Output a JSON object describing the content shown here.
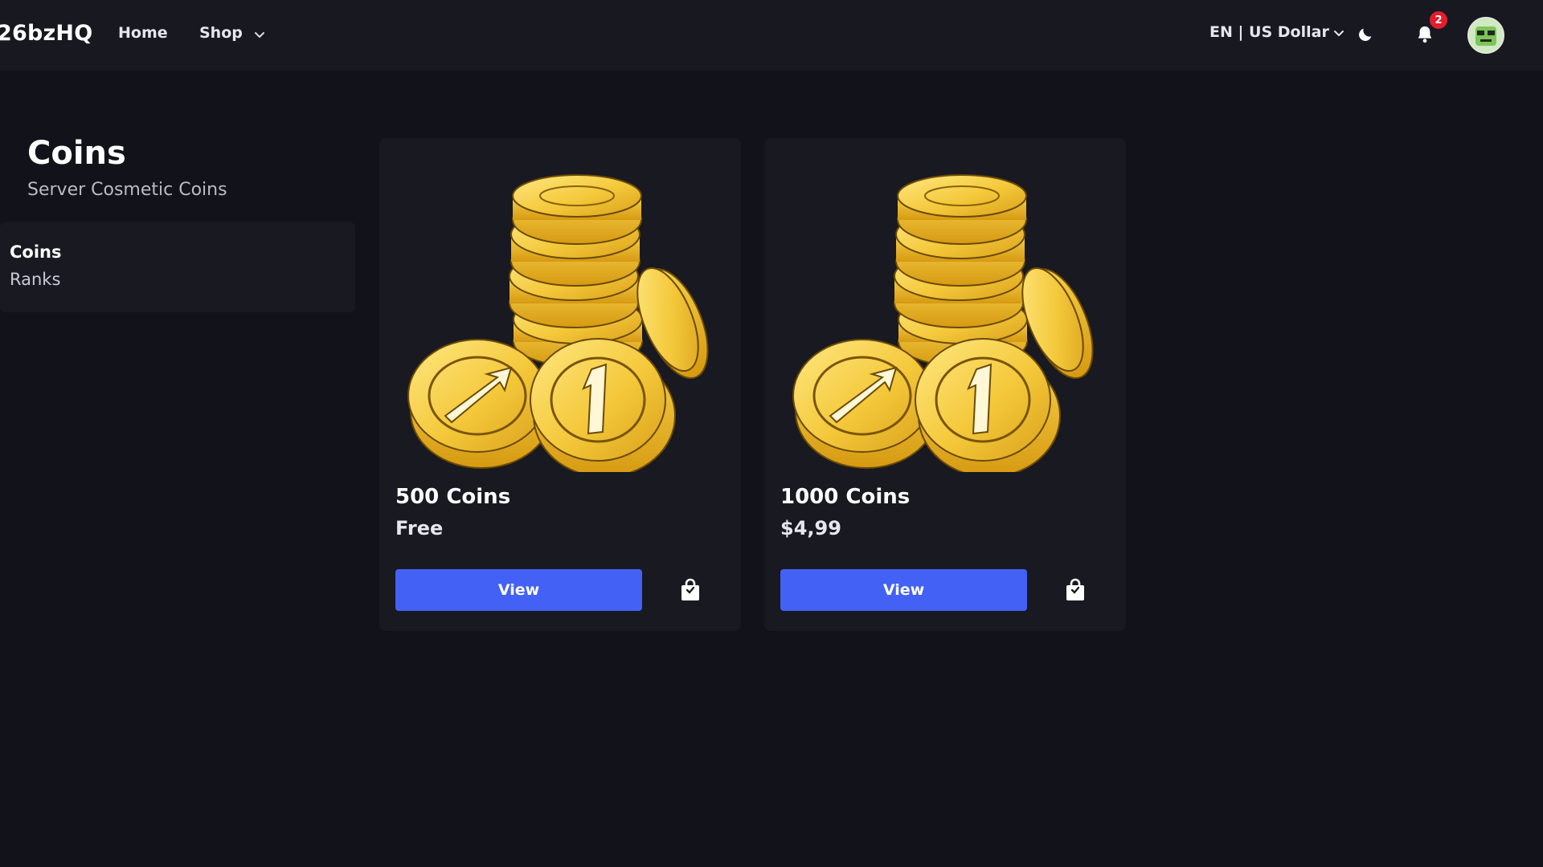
{
  "header": {
    "brand": "26bzHQ",
    "nav": {
      "home": "Home",
      "shop": "Shop"
    },
    "locale": "EN | US Dollar",
    "notifications_count": "2",
    "icons": {
      "shop_dropdown": "chevron-down-icon",
      "locale_dropdown": "chevron-down-icon",
      "theme_toggle": "moon-icon",
      "notifications": "bell-icon",
      "profile": "avatar"
    }
  },
  "sidebar": {
    "title": "Coins",
    "subtitle": "Server Cosmetic Coins",
    "categories": [
      {
        "label": "Coins",
        "active": true
      },
      {
        "label": "Ranks",
        "active": false
      }
    ]
  },
  "products": [
    {
      "name": "500 Coins",
      "price": "Free",
      "view_label": "View",
      "image": "gold-coins-stack",
      "cart_icon": "shopping-bag-icon"
    },
    {
      "name": "1000 Coins",
      "price": "$4,99",
      "view_label": "View",
      "image": "gold-coins-stack",
      "cart_icon": "shopping-bag-icon"
    }
  ],
  "colors": {
    "background": "#12131a",
    "header": "#171820",
    "card": "#181921",
    "accent": "#4361f5",
    "badge": "#e11d2e",
    "coin_gold": "#f2c531"
  }
}
